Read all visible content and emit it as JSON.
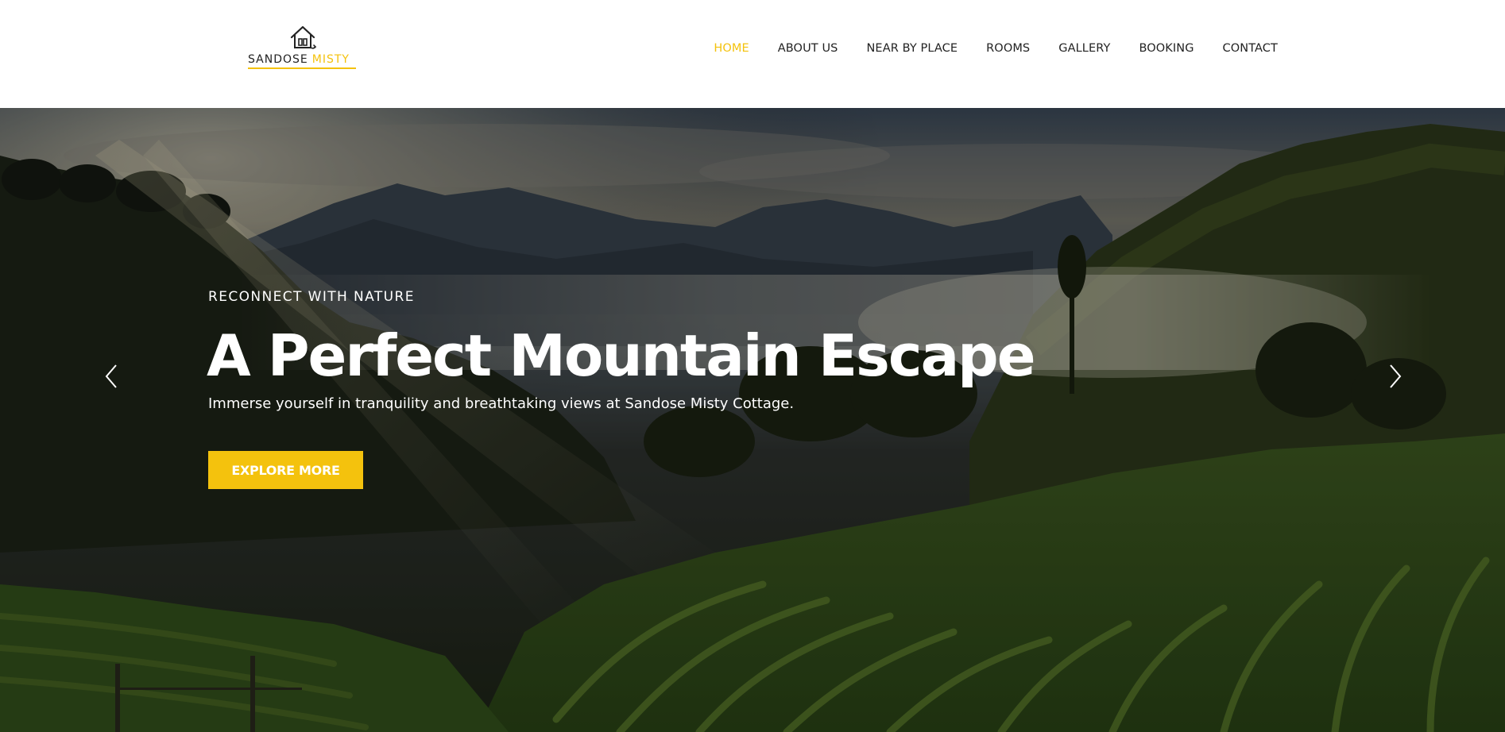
{
  "brand": {
    "name_part1": "SANDOSE",
    "name_part2": "MISTY",
    "accent_color": "#f4c20d",
    "logo_icon": "house-icon"
  },
  "nav": {
    "items": [
      {
        "label": "HOME",
        "active": true
      },
      {
        "label": "ABOUT US",
        "active": false
      },
      {
        "label": "NEAR BY PLACE",
        "active": false
      },
      {
        "label": "ROOMS",
        "active": false
      },
      {
        "label": "GALLERY",
        "active": false
      },
      {
        "label": "BOOKING",
        "active": false
      },
      {
        "label": "CONTACT",
        "active": false
      }
    ]
  },
  "hero": {
    "eyebrow": "RECONNECT WITH NATURE",
    "title": "A Perfect Mountain Escape",
    "subtitle": "Immerse yourself in tranquility and breathtaking views at Sandose Misty Cottage.",
    "cta_label": "EXPLORE MORE",
    "prev_icon": "chevron-left-icon",
    "next_icon": "chevron-right-icon"
  }
}
